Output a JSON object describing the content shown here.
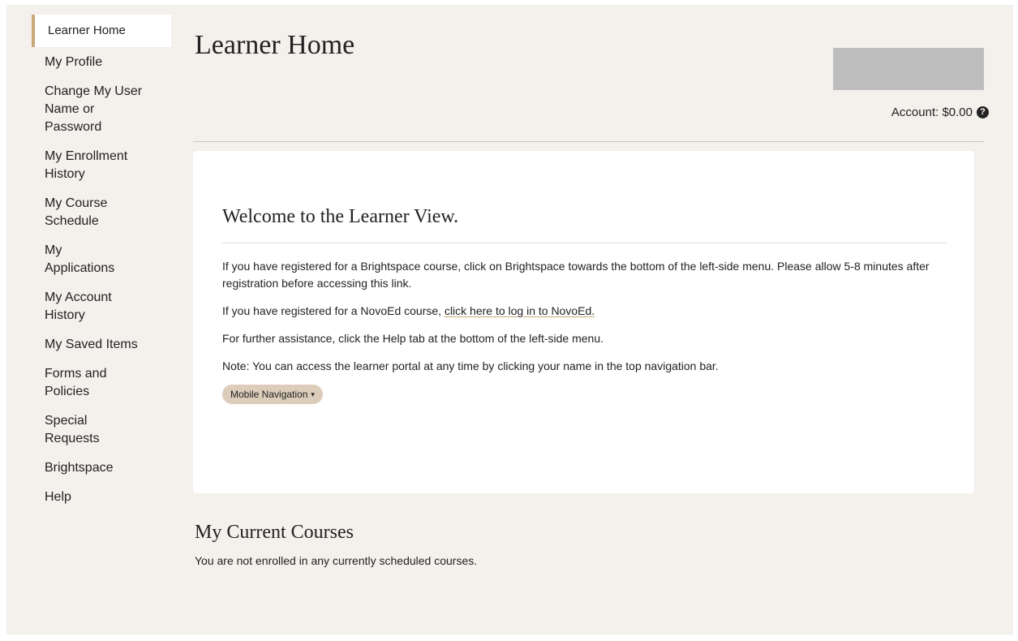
{
  "sidebar": {
    "items": [
      {
        "label": "Learner Home",
        "active": true
      },
      {
        "label": "My Profile"
      },
      {
        "label": "Change My User Name or Password"
      },
      {
        "label": "My Enrollment History"
      },
      {
        "label": "My Course Schedule"
      },
      {
        "label": "My Applications"
      },
      {
        "label": "My Account History"
      },
      {
        "label": "My Saved Items"
      },
      {
        "label": "Forms and Policies"
      },
      {
        "label": "Special Requests"
      },
      {
        "label": "Brightspace"
      },
      {
        "label": "Help"
      }
    ]
  },
  "header": {
    "title": "Learner Home",
    "account_label": "Account: $0.00",
    "help_icon": "question-circle-icon"
  },
  "welcome": {
    "title": "Welcome to the Learner View.",
    "p1_a": "If you have registered for a Brightspace course, click on ",
    "p1_bold": "Brightspace",
    "p1_b": " towards the bottom of the left-side menu. Please allow 5-8 minutes after registration before accessing this link.",
    "p2_a": "If you have registered for a NovoEd course, ",
    "p2_link": "click here to log in to NovoEd. ",
    "p3_a": "For further assistance, click the ",
    "p3_bold": "Help",
    "p3_b": " tab at the bottom of the left-side menu.",
    "p4_bold": "Note",
    "p4_b": ": You can access the learner portal at any time by clicking your name in the top navigation bar.",
    "mobile_nav_label": "Mobile Navigation"
  },
  "courses": {
    "title": "My Current Courses",
    "empty_text": "You are not enrolled in any currently scheduled courses."
  }
}
